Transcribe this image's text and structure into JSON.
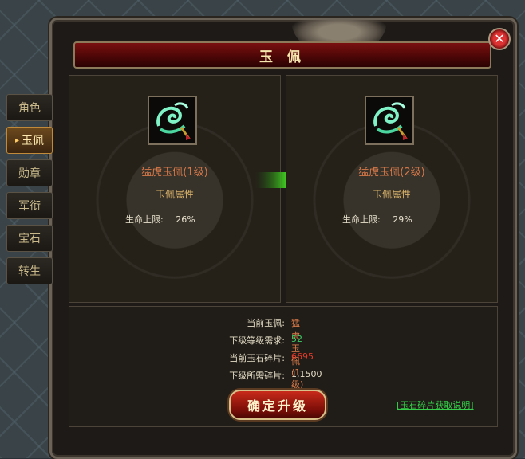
{
  "window": {
    "title": "玉 佩",
    "close_icon": "✕"
  },
  "tabs": [
    {
      "label": "角色",
      "active": false
    },
    {
      "label": "玉佩",
      "active": true
    },
    {
      "label": "勋章",
      "active": false
    },
    {
      "label": "军衔",
      "active": false
    },
    {
      "label": "宝石",
      "active": false
    },
    {
      "label": "转生",
      "active": false
    }
  ],
  "current": {
    "icon": "jade-pendant-icon",
    "name": "猛虎玉佩(1级)",
    "attr_title": "玉佩属性",
    "stat_label": "生命上限:",
    "stat_value": "26%"
  },
  "next": {
    "icon": "jade-pendant-icon",
    "name": "猛虎玉佩(2级)",
    "attr_title": "玉佩属性",
    "stat_label": "生命上限:",
    "stat_value": "29%"
  },
  "info": {
    "current_pendant_label": "当前玉佩:",
    "current_pendant_value": "猛虎玉佩(1级)",
    "next_level_req_label": "下级等级需求:",
    "next_level_req_value": "52",
    "current_fragments_label": "当前玉石碎片:",
    "current_fragments_value": "6695",
    "next_fragments_label": "下级所需碎片:",
    "next_fragments_value": "1,1500"
  },
  "upgrade_button": "确定升级",
  "help_link": "[玉石碎片获取说明]",
  "colors": {
    "name_orange": "#d87a4a",
    "value_green": "#3fd06a",
    "value_red": "#e23b2b",
    "link_green": "#35d04a"
  }
}
